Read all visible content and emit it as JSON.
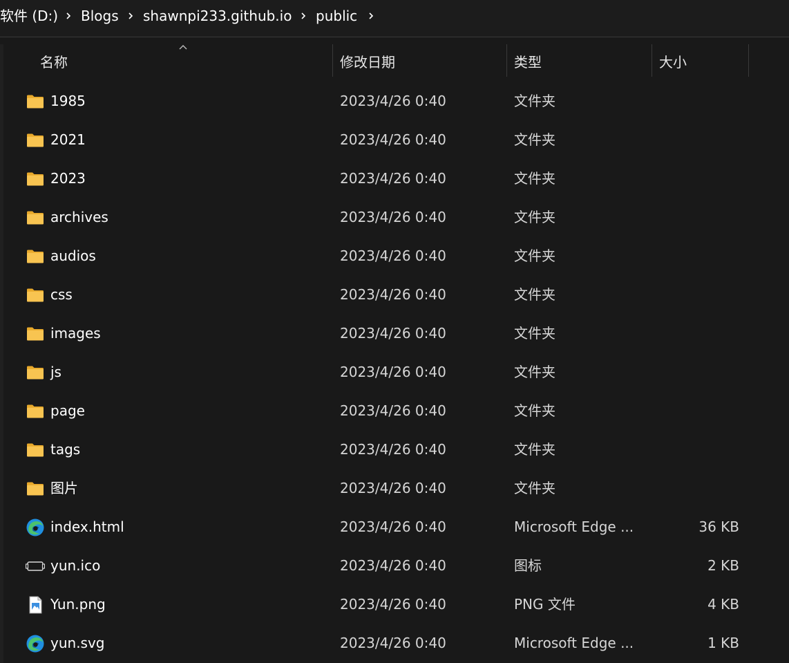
{
  "breadcrumb": {
    "items": [
      "软件 (D:)",
      "Blogs",
      "shawnpi233.github.io",
      "public"
    ]
  },
  "columns": {
    "name": "名称",
    "date": "修改日期",
    "type": "类型",
    "size": "大小",
    "sort_indicator": "sort-ascending-caret-icon"
  },
  "colors": {
    "background": "#191919",
    "folder": "#f8c451",
    "edge_blue": "#1f8fe0",
    "edge_green": "#4cc26d"
  },
  "files": [
    {
      "name": "1985",
      "date": "2023/4/26 0:40",
      "type": "文件夹",
      "size": "",
      "icon": "folder-icon"
    },
    {
      "name": "2021",
      "date": "2023/4/26 0:40",
      "type": "文件夹",
      "size": "",
      "icon": "folder-icon"
    },
    {
      "name": "2023",
      "date": "2023/4/26 0:40",
      "type": "文件夹",
      "size": "",
      "icon": "folder-icon"
    },
    {
      "name": "archives",
      "date": "2023/4/26 0:40",
      "type": "文件夹",
      "size": "",
      "icon": "folder-icon"
    },
    {
      "name": "audios",
      "date": "2023/4/26 0:40",
      "type": "文件夹",
      "size": "",
      "icon": "folder-icon"
    },
    {
      "name": "css",
      "date": "2023/4/26 0:40",
      "type": "文件夹",
      "size": "",
      "icon": "folder-icon"
    },
    {
      "name": "images",
      "date": "2023/4/26 0:40",
      "type": "文件夹",
      "size": "",
      "icon": "folder-icon"
    },
    {
      "name": "js",
      "date": "2023/4/26 0:40",
      "type": "文件夹",
      "size": "",
      "icon": "folder-icon"
    },
    {
      "name": "page",
      "date": "2023/4/26 0:40",
      "type": "文件夹",
      "size": "",
      "icon": "folder-icon"
    },
    {
      "name": "tags",
      "date": "2023/4/26 0:40",
      "type": "文件夹",
      "size": "",
      "icon": "folder-icon"
    },
    {
      "name": "图片",
      "date": "2023/4/26 0:40",
      "type": "文件夹",
      "size": "",
      "icon": "folder-icon"
    },
    {
      "name": "index.html",
      "date": "2023/4/26 0:40",
      "type": "Microsoft Edge ...",
      "size": "36 KB",
      "icon": "edge-icon"
    },
    {
      "name": "yun.ico",
      "date": "2023/4/26 0:40",
      "type": "图标",
      "size": "2 KB",
      "icon": "ico-file-icon"
    },
    {
      "name": "Yun.png",
      "date": "2023/4/26 0:40",
      "type": "PNG 文件",
      "size": "4 KB",
      "icon": "image-file-icon"
    },
    {
      "name": "yun.svg",
      "date": "2023/4/26 0:40",
      "type": "Microsoft Edge ...",
      "size": "1 KB",
      "icon": "edge-icon"
    }
  ]
}
